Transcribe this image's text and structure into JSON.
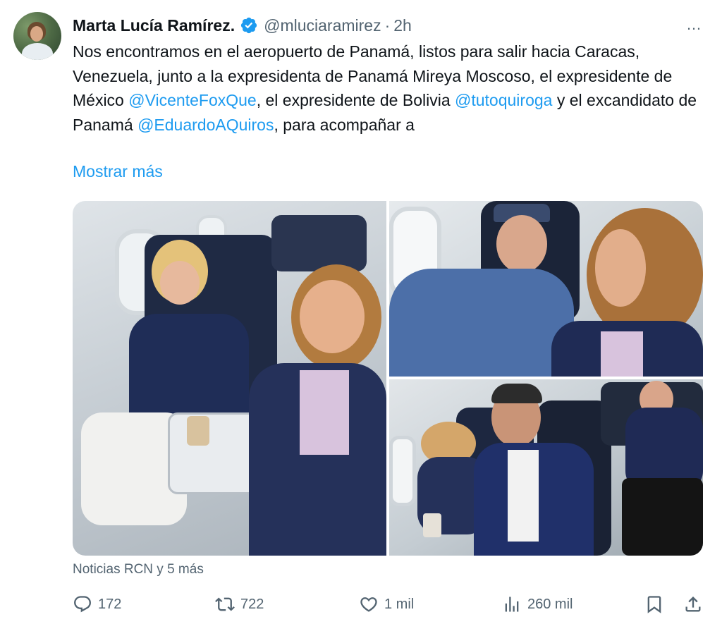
{
  "tweet": {
    "author": "Marta Lucía Ramírez.",
    "handle": "@mluciaramirez",
    "separator": "·",
    "time": "2h",
    "more_icon": "…",
    "text_parts": [
      "Nos encontramos en el aeropuerto de Panamá, listos para salir hacia Caracas, Venezuela, junto a la expresidenta de Panamá Mireya Moscoso, el expresidente de México ",
      "@VicenteFoxQue",
      ", el expresidente de Bolivia ",
      "@tutoquiroga",
      " y el excandidato de Panamá ",
      "@EduardoAQuiros",
      ", para acompañar a"
    ],
    "show_more": "Mostrar más",
    "source": "Noticias RCN y 5 más",
    "verified_color": "#1d9bf0",
    "accent": "#1d9bf0"
  },
  "actions": {
    "reply": "172",
    "retweet": "722",
    "like": "1 mil",
    "views": "260 mil"
  },
  "icons": [
    "verified-badge-icon",
    "more-icon",
    "reply-icon",
    "retweet-icon",
    "like-icon",
    "views-icon",
    "bookmark-icon",
    "share-icon"
  ]
}
